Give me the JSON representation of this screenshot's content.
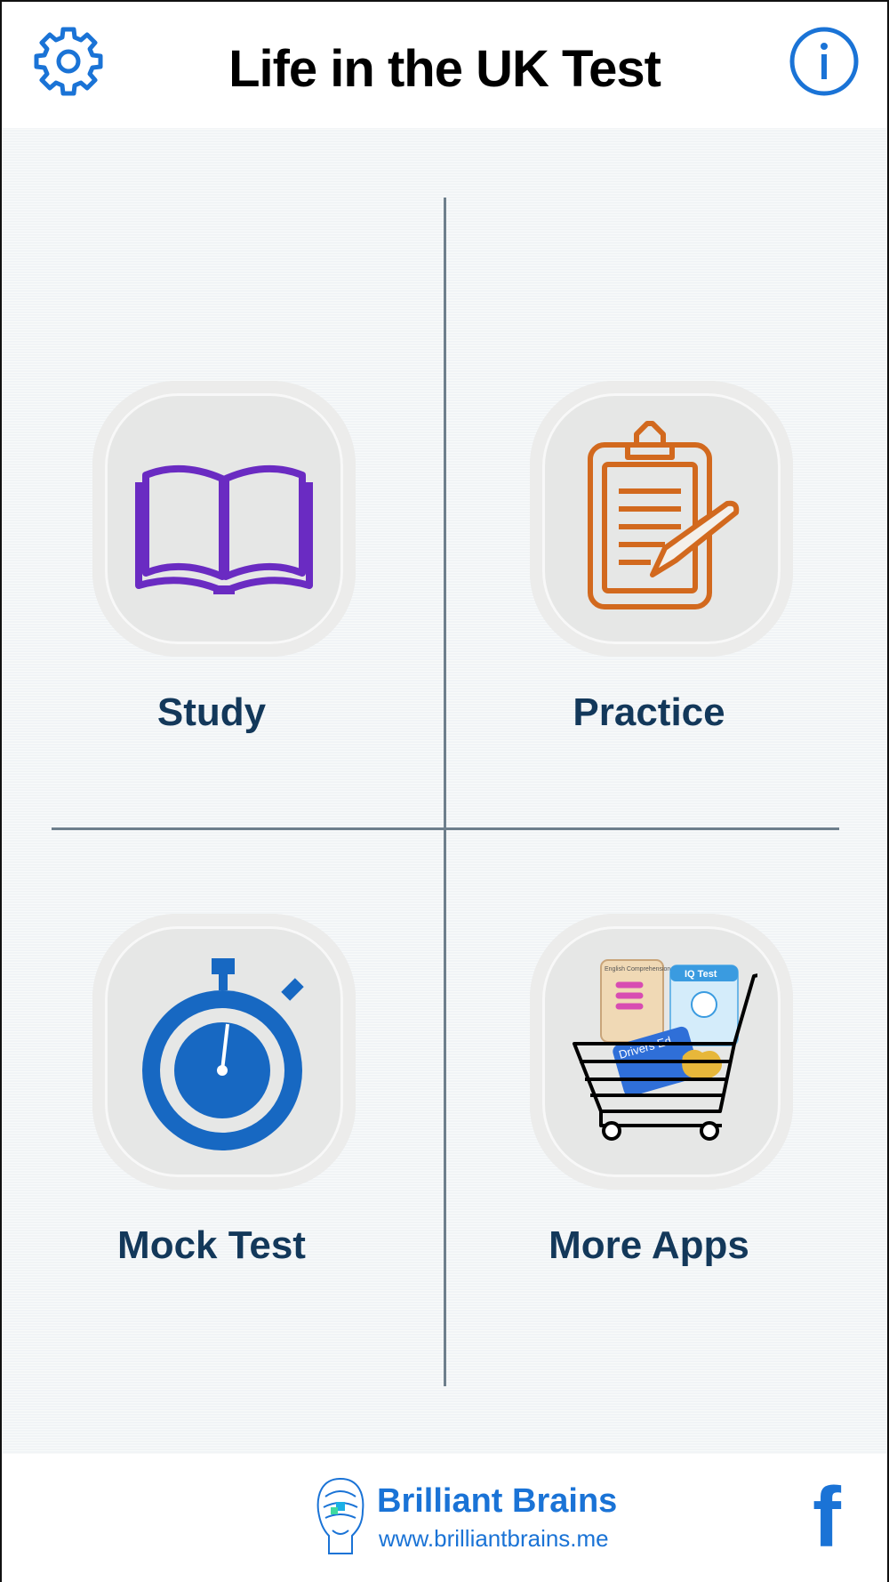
{
  "header": {
    "title": "Life in the UK Test"
  },
  "tiles": {
    "study": {
      "label": "Study"
    },
    "practice": {
      "label": "Practice"
    },
    "mock": {
      "label": "Mock Test"
    },
    "more": {
      "label": "More Apps"
    }
  },
  "more_apps_icon": {
    "app1": "English Comprehension",
    "app2": "IQ Test",
    "app3": "Drivers Ed"
  },
  "footer": {
    "brand_name": "Brilliant Brains",
    "brand_url": "www.brilliantbrains.me"
  },
  "colors": {
    "accent": "#1a73d6",
    "label": "#13385a",
    "study_icon": "#6a2bc2",
    "practice_icon": "#d2691e",
    "mock_icon": "#1768c2"
  }
}
